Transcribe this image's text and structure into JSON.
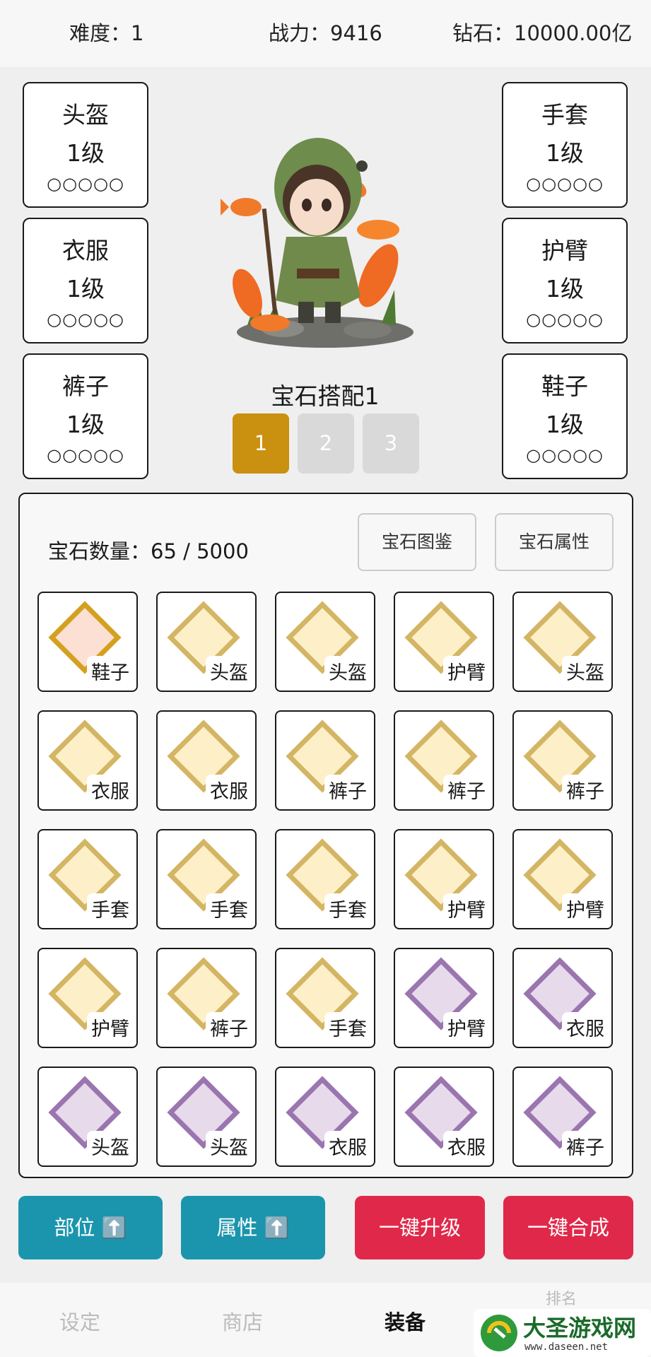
{
  "top": {
    "difficulty": "难度：1",
    "power": "战力：9416",
    "diamonds": "钻石：10000.00亿"
  },
  "equipment": {
    "left": [
      {
        "name": "头盔",
        "level": "1级",
        "gems": "○○○○○"
      },
      {
        "name": "衣服",
        "level": "1级",
        "gems": "○○○○○"
      },
      {
        "name": "裤子",
        "level": "1级",
        "gems": "○○○○○"
      }
    ],
    "right": [
      {
        "name": "手套",
        "level": "1级",
        "gems": "○○○○○"
      },
      {
        "name": "护臂",
        "level": "1级",
        "gems": "○○○○○"
      },
      {
        "name": "鞋子",
        "level": "1级",
        "gems": "○○○○○"
      }
    ]
  },
  "loadout": {
    "title": "宝石搭配1",
    "buttons": [
      "1",
      "2",
      "3"
    ],
    "active": "1"
  },
  "gem_panel": {
    "count_label": "宝石数量：65 / 5000",
    "catalog_button": "宝石图鉴",
    "attribute_button": "宝石属性",
    "gems": [
      [
        {
          "tag": "鞋子",
          "color": "orange"
        },
        {
          "tag": "头盔",
          "color": "yellow"
        },
        {
          "tag": "头盔",
          "color": "yellow"
        },
        {
          "tag": "护臂",
          "color": "yellow"
        },
        {
          "tag": "头盔",
          "color": "yellow"
        }
      ],
      [
        {
          "tag": "衣服",
          "color": "yellow"
        },
        {
          "tag": "衣服",
          "color": "yellow"
        },
        {
          "tag": "裤子",
          "color": "yellow"
        },
        {
          "tag": "裤子",
          "color": "yellow"
        },
        {
          "tag": "裤子",
          "color": "yellow"
        }
      ],
      [
        {
          "tag": "手套",
          "color": "yellow"
        },
        {
          "tag": "手套",
          "color": "yellow"
        },
        {
          "tag": "手套",
          "color": "yellow"
        },
        {
          "tag": "护臂",
          "color": "yellow"
        },
        {
          "tag": "护臂",
          "color": "yellow"
        }
      ],
      [
        {
          "tag": "护臂",
          "color": "yellow"
        },
        {
          "tag": "裤子",
          "color": "yellow"
        },
        {
          "tag": "手套",
          "color": "yellow"
        },
        {
          "tag": "护臂",
          "color": "purple"
        },
        {
          "tag": "衣服",
          "color": "purple"
        }
      ],
      [
        {
          "tag": "头盔",
          "color": "purple"
        },
        {
          "tag": "头盔",
          "color": "purple"
        },
        {
          "tag": "衣服",
          "color": "purple"
        },
        {
          "tag": "衣服",
          "color": "purple"
        },
        {
          "tag": "裤子",
          "color": "purple"
        }
      ]
    ]
  },
  "actions": {
    "part_sort": "部位 ⬆️",
    "attr_sort": "属性 ⬆️",
    "upgrade_all": "一键升级",
    "merge_all": "一键合成"
  },
  "nav": {
    "settings": "设定",
    "shop": "商店",
    "equipment": "装备",
    "fourth": "排名"
  },
  "watermark": {
    "title": "大圣游戏网",
    "url": "www.daseen.net"
  },
  "colors": {
    "loadout_active": "#c9910f",
    "action_blue": "#1b95ad",
    "action_red": "#e0294a",
    "gem_yellow_stroke": "#d4b564",
    "gem_yellow_fill": "#fdf0c8",
    "gem_orange_stroke": "#d4a020",
    "gem_orange_fill": "#fde0d4",
    "gem_purple_stroke": "#9a75b0",
    "gem_purple_fill": "#e7daea"
  }
}
